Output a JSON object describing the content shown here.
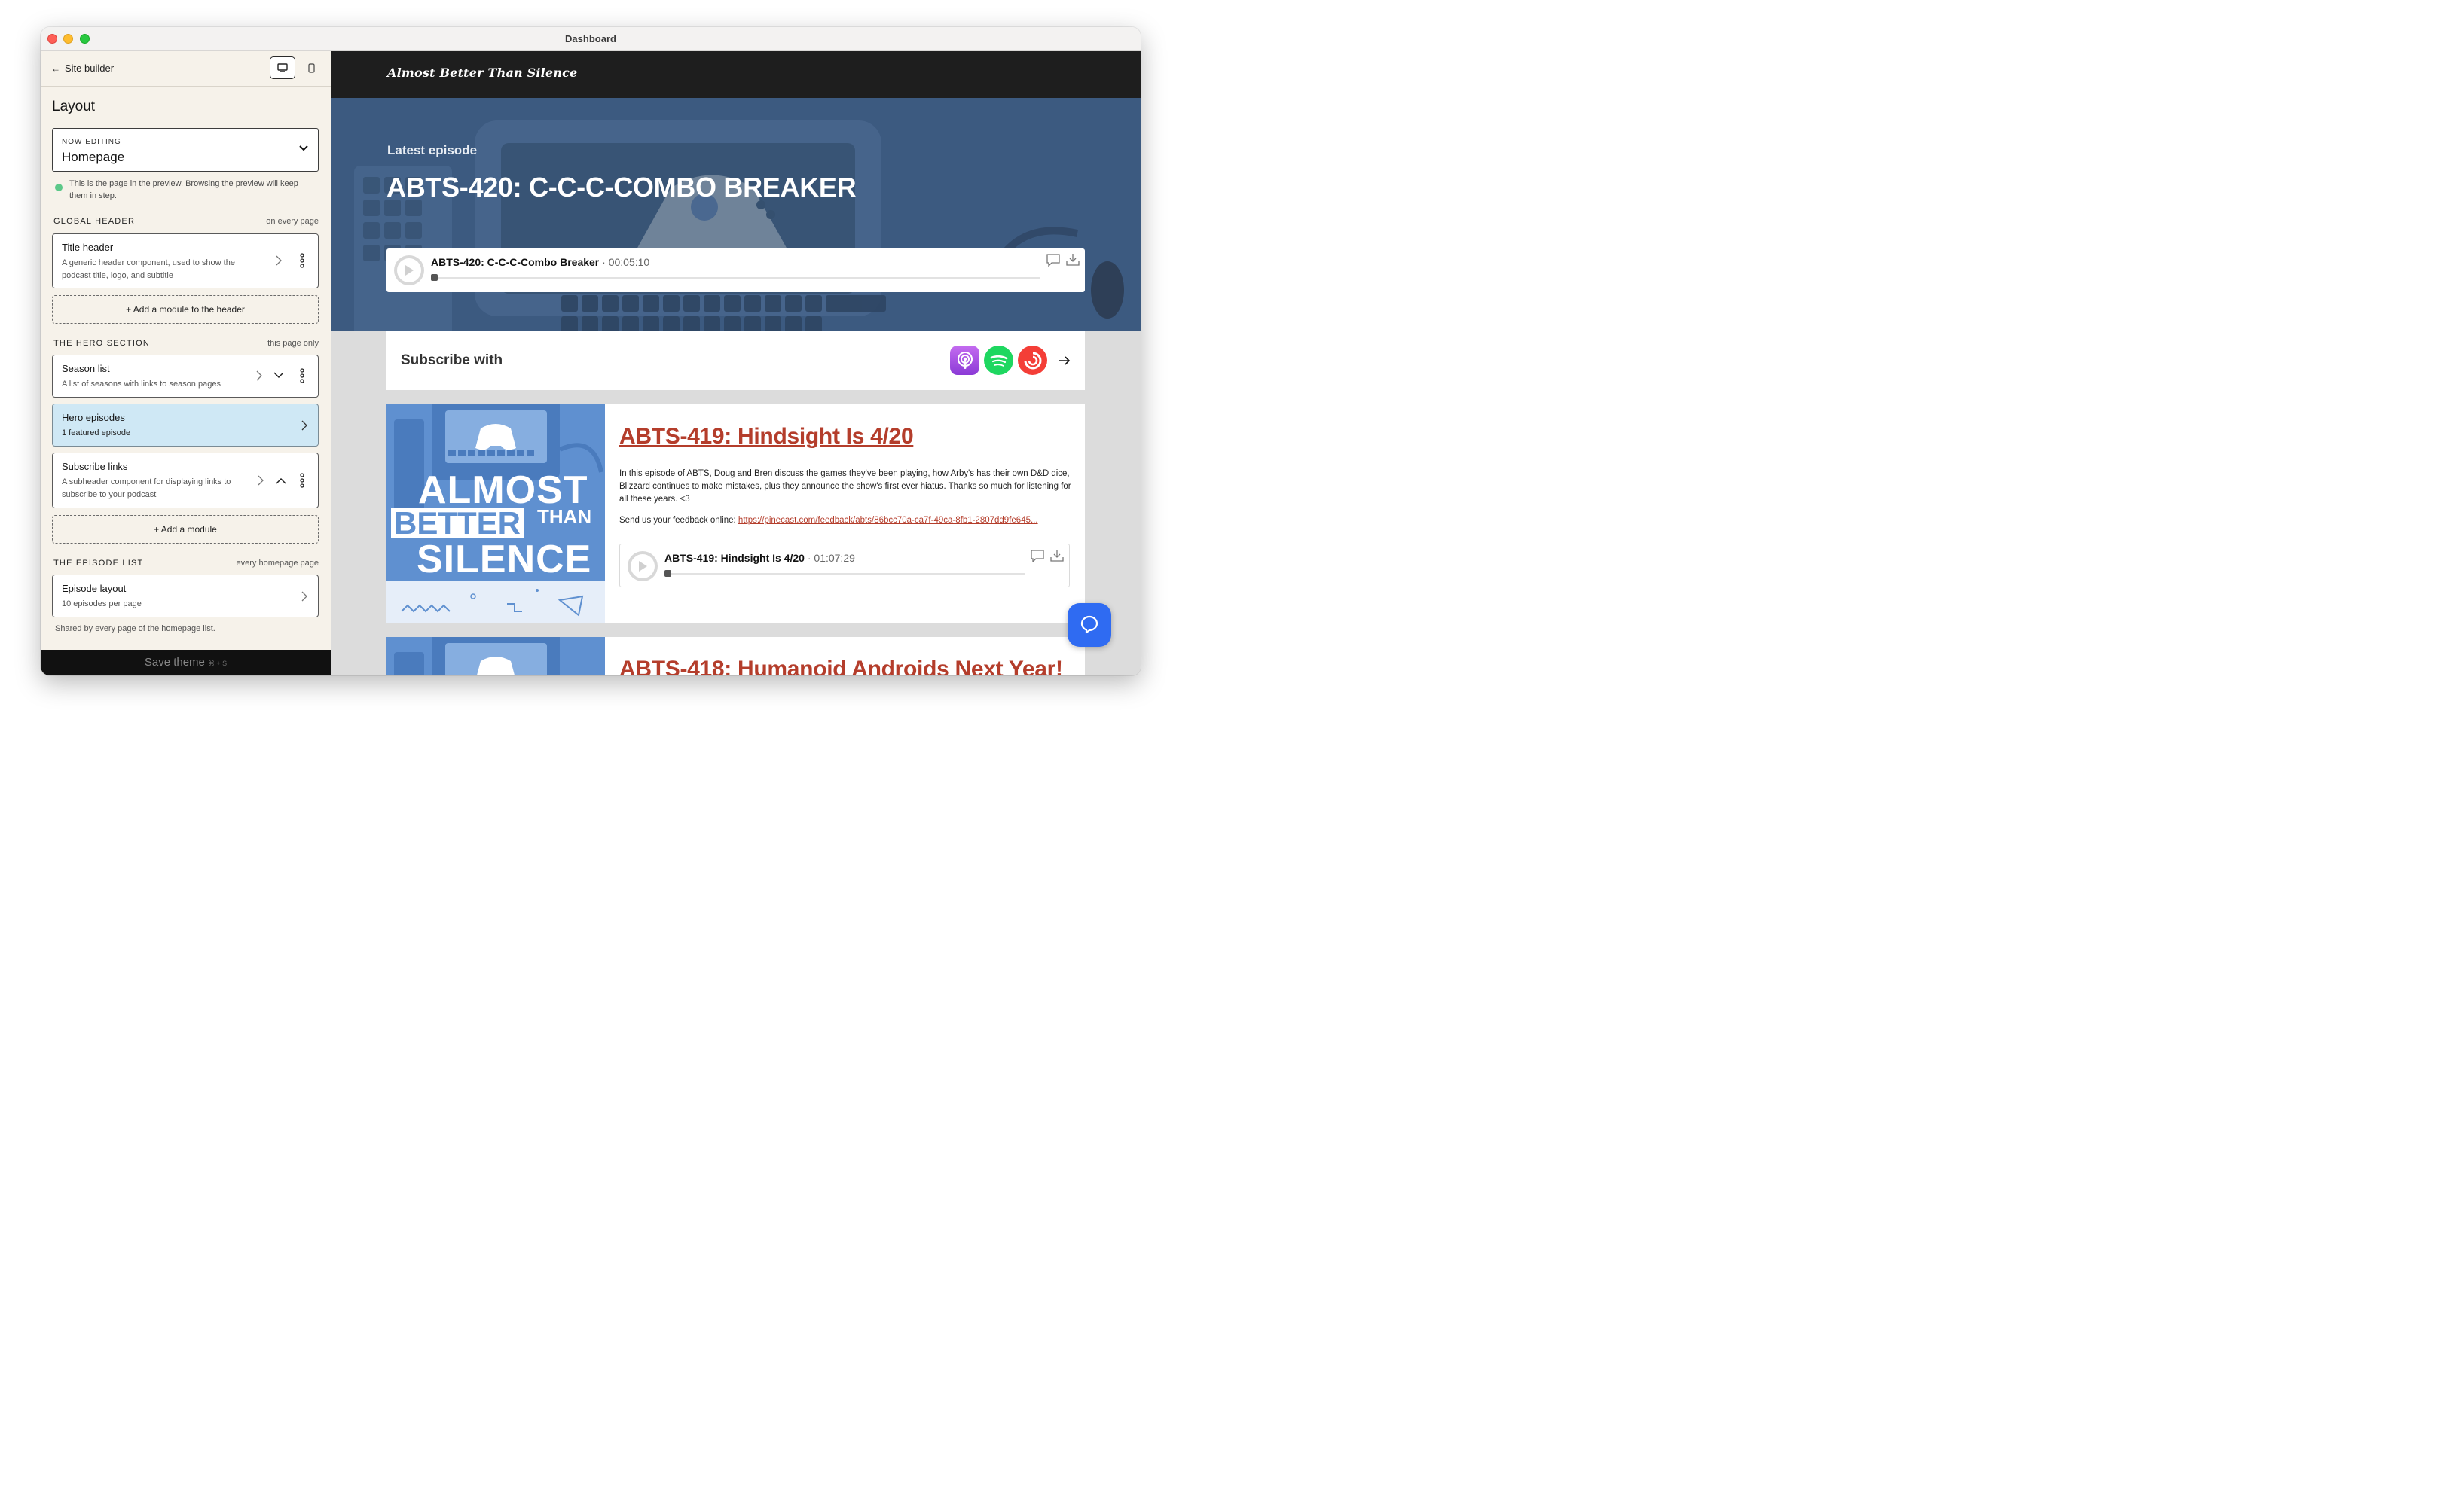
{
  "window": {
    "title": "Dashboard"
  },
  "sidebar": {
    "back_label": "Site builder",
    "section_title": "Layout",
    "now_editing": {
      "label": "NOW EDITING",
      "value": "Homepage"
    },
    "hint": "This is the page in the preview. Browsing the preview will keep them in step.",
    "global_header": {
      "label": "GLOBAL HEADER",
      "scope": "on every page",
      "modules": [
        {
          "title": "Title header",
          "desc": "A generic header component, used to show the podcast title, logo, and subtitle"
        }
      ],
      "add_label": "+ Add a module to the header"
    },
    "hero_section": {
      "label": "THE HERO SECTION",
      "scope": "this page only",
      "modules": [
        {
          "title": "Season list",
          "desc": "A list of seasons with links to season pages"
        },
        {
          "title": "Hero episodes",
          "desc": "1 featured episode"
        },
        {
          "title": "Subscribe links",
          "desc": "A subheader component for displaying links to subscribe to your podcast"
        }
      ],
      "add_label": "+ Add a module"
    },
    "episode_list": {
      "label": "THE EPISODE LIST",
      "scope": "every homepage page",
      "modules": [
        {
          "title": "Episode layout",
          "desc": "10 episodes per page"
        }
      ],
      "shared_note": "Shared by every page of the homepage list."
    },
    "save": {
      "label": "Save theme",
      "shortcut": "⌘ + S"
    }
  },
  "preview": {
    "site_title": "Almost Better Than Silence",
    "hero": {
      "kicker": "Latest episode",
      "title": "ABTS-420: C-C-C-COMBO BREAKER",
      "player": {
        "title": "ABTS-420: C-C-C-Combo Breaker",
        "time": "00:05:10"
      }
    },
    "subscribe": {
      "label": "Subscribe with",
      "icons": [
        "apple-podcasts-icon",
        "spotify-icon",
        "pocket-casts-icon"
      ]
    },
    "episodes": [
      {
        "title": "ABTS-419: Hindsight Is 4/20",
        "description": "In this episode of ABTS, Doug and Bren discuss the games they've been playing, how Arby's has their own D&D dice, Blizzard continues to make mistakes, plus they announce the show's first ever hiatus. Thanks so much for listening for all these years. <3",
        "feedback_label": "Send us your feedback online:",
        "feedback_link": "https://pinecast.com/feedback/abts/86bcc70a-ca7f-49ca-8fb1-2807dd9fe645...",
        "player": {
          "title": "ABTS-419: Hindsight Is 4/20",
          "time": "01:07:29"
        },
        "art_text": [
          "ALMOST",
          "BETTER",
          "THAN",
          "SILENCE"
        ]
      },
      {
        "title": "ABTS-418: Humanoid Androids Next Year!"
      }
    ]
  },
  "colors": {
    "sidebar_bg": "#f6f2ea",
    "highlight_card": "#cfe8f5",
    "hero_bg": "#3c5a80",
    "episode_title": "#b43d2b",
    "chat_button": "#2f6bf2"
  }
}
